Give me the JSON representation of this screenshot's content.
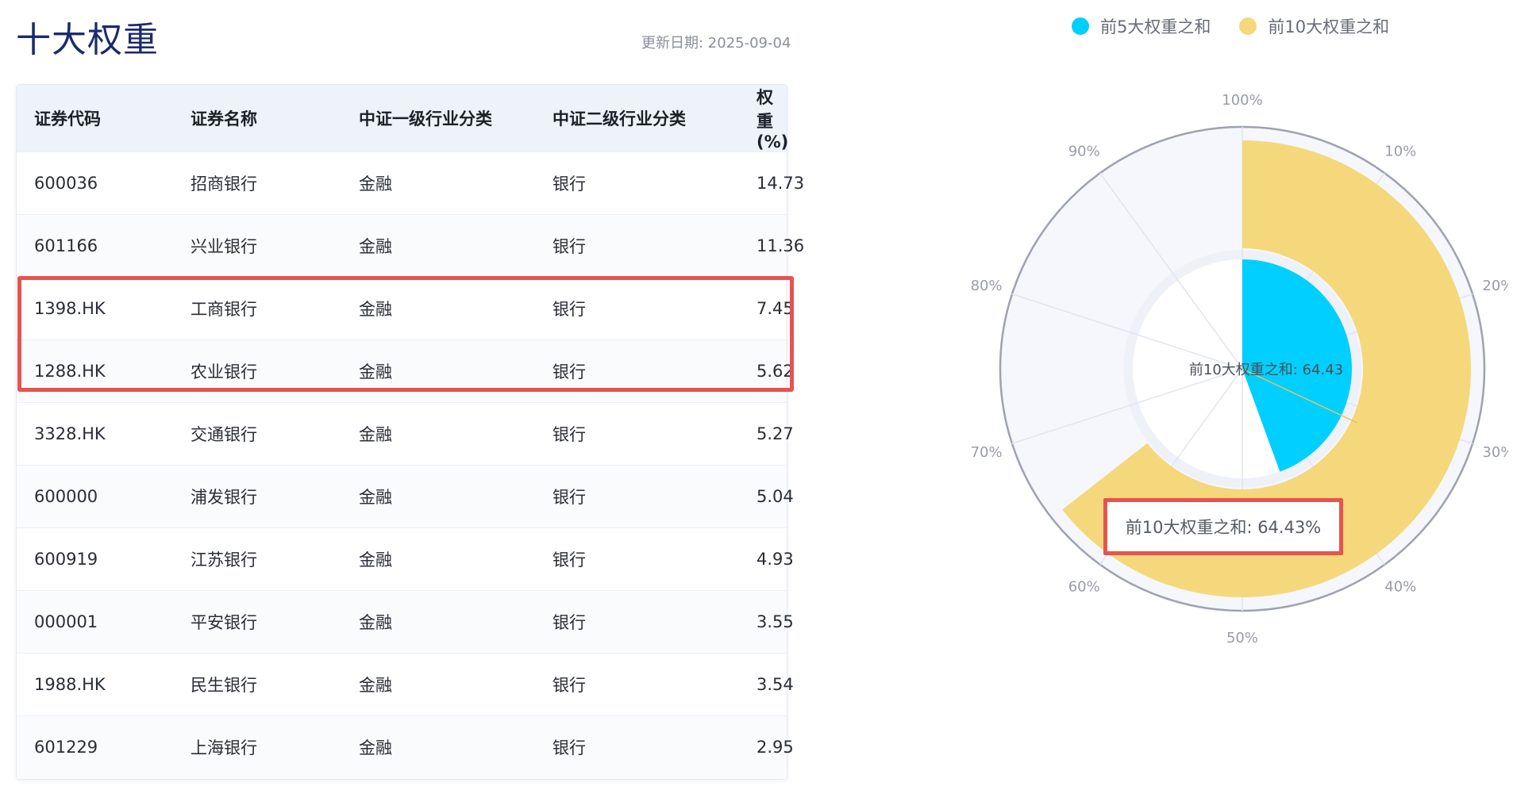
{
  "header": {
    "title": "十大权重",
    "update_date": "更新日期: 2025-09-04"
  },
  "table": {
    "columns": [
      "证券代码",
      "证券名称",
      "中证一级行业分类",
      "中证二级行业分类",
      "权重(%)"
    ],
    "rows": [
      [
        "600036",
        "招商银行",
        "金融",
        "银行",
        "14.73"
      ],
      [
        "601166",
        "兴业银行",
        "金融",
        "银行",
        "11.36"
      ],
      [
        "1398.HK",
        "工商银行",
        "金融",
        "银行",
        "7.45"
      ],
      [
        "1288.HK",
        "农业银行",
        "金融",
        "银行",
        "5.62"
      ],
      [
        "3328.HK",
        "交通银行",
        "金融",
        "银行",
        "5.27"
      ],
      [
        "600000",
        "浦发银行",
        "金融",
        "银行",
        "5.04"
      ],
      [
        "600919",
        "江苏银行",
        "金融",
        "银行",
        "4.93"
      ],
      [
        "000001",
        "平安银行",
        "金融",
        "银行",
        "3.55"
      ],
      [
        "1988.HK",
        "民生银行",
        "金融",
        "银行",
        "3.54"
      ],
      [
        "601229",
        "上海银行",
        "金融",
        "银行",
        "2.95"
      ]
    ]
  },
  "chart_data": {
    "type": "polar-bar",
    "legend": [
      {
        "name": "前5大权重之和",
        "color": "#00cfff"
      },
      {
        "name": "前10大权重之和",
        "color": "#f5d87c"
      }
    ],
    "series": [
      {
        "name": "前5大权重之和",
        "value": 44.43,
        "color": "#00cfff"
      },
      {
        "name": "前10大权重之和",
        "value": 64.43,
        "color": "#f5d87c"
      }
    ],
    "angle_ticks": [
      "100%",
      "10%",
      "20%",
      "30%",
      "40%",
      "50%",
      "60%",
      "70%",
      "80%",
      "90%"
    ],
    "center_label": "前10大权重之和: 64.43",
    "tooltip": "前10大权重之和: 64.43%"
  }
}
